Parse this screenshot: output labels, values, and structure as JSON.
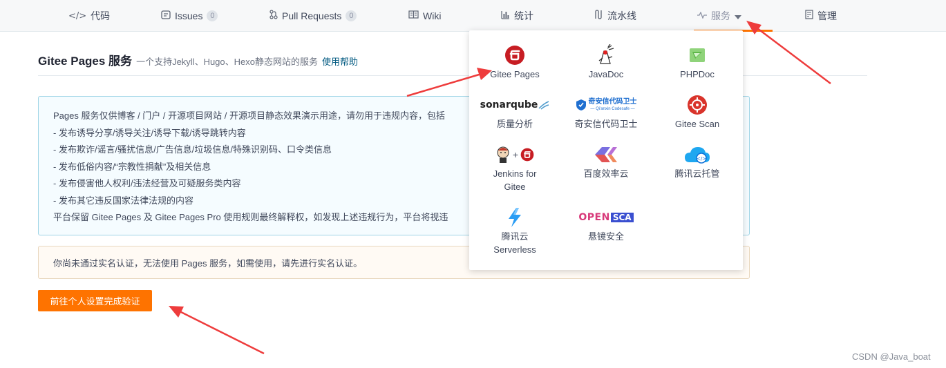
{
  "nav": {
    "items": [
      {
        "label": "代码",
        "icon": "code-icon"
      },
      {
        "label": "Issues",
        "badge": "0",
        "icon": "issues-icon"
      },
      {
        "label": "Pull Requests",
        "badge": "0",
        "icon": "pull-request-icon"
      },
      {
        "label": "Wiki",
        "icon": "book-icon"
      },
      {
        "label": "统计",
        "icon": "bar-chart-icon"
      },
      {
        "label": "流水线",
        "icon": "pipeline-icon"
      },
      {
        "label": "服务",
        "icon": "pulse-icon",
        "active": true
      },
      {
        "label": "管理",
        "icon": "manage-icon"
      }
    ],
    "accent": "#fe7300"
  },
  "header": {
    "title": "Gitee Pages 服务",
    "subtitle": "一个支持Jekyll、Hugo、Hexo静态网站的服务",
    "help_link": "使用帮助"
  },
  "notice": {
    "lines": [
      "Pages 服务仅供博客 / 门户 / 开源项目网站 / 开源项目静态效果演示用途，请勿用于违规内容，包括",
      "- 发布诱导分享/诱导关注/诱导下载/诱导跳转内容",
      "- 发布欺诈/谣言/骚扰信息/广告信息/垃圾信息/特殊识别码、口令类信息",
      "- 发布低俗内容/“宗教性捐献”及相关信息",
      "- 发布侵害他人权利/违法经营及可疑服务类内容",
      "- 发布其它违反国家法律法规的内容",
      "平台保留 Gitee Pages 及 Gitee Pages Pro 使用规则最终解释权，如发现上述违规行为，平台将视违"
    ]
  },
  "warning": {
    "text": "你尚未通过实名认证，无法使用 Pages 服务，如需使用，请先进行实名认证。"
  },
  "verify_button": {
    "label": "前往个人设置完成验证"
  },
  "services_menu": {
    "items": [
      {
        "label": "Gitee Pages",
        "logo": "gitee-logo"
      },
      {
        "label": "JavaDoc",
        "logo": "duke-logo"
      },
      {
        "label": "PHPDoc",
        "logo": "phpdoc-logo"
      },
      {
        "label": "质量分析",
        "logo": "sonarqube-logo",
        "logo_text": "sonarqube"
      },
      {
        "label": "奇安信代码卫士",
        "logo": "qianxin-logo",
        "logo_text": "奇安信代码卫士",
        "logo_subtext": "— Qi'anxin Codesafe —"
      },
      {
        "label": "Gitee Scan",
        "logo": "gitee-scan-logo"
      },
      {
        "label": "Jenkins for\nGitee",
        "label_lines": [
          "Jenkins for",
          "Gitee"
        ],
        "logo": "jenkins-gitee-logo"
      },
      {
        "label": "百度效率云",
        "logo": "baidu-efficiency-logo"
      },
      {
        "label": "腾讯云托管",
        "logo": "tencent-cloud-logo"
      },
      {
        "label_lines": [
          "腾讯云",
          "Serverless"
        ],
        "logo": "tencent-serverless-logo"
      },
      {
        "label": "悬镜安全",
        "logo": "opensca-logo",
        "logo_text": [
          "OPEN",
          "SCA"
        ]
      }
    ]
  },
  "watermark": "CSDN @Java_boat",
  "colors": {
    "gitee_red": "#c71d23",
    "annotation_arrow": "#ee3c3c",
    "notice_border": "#9ed4e6",
    "warn_border": "#e8d6bd"
  }
}
